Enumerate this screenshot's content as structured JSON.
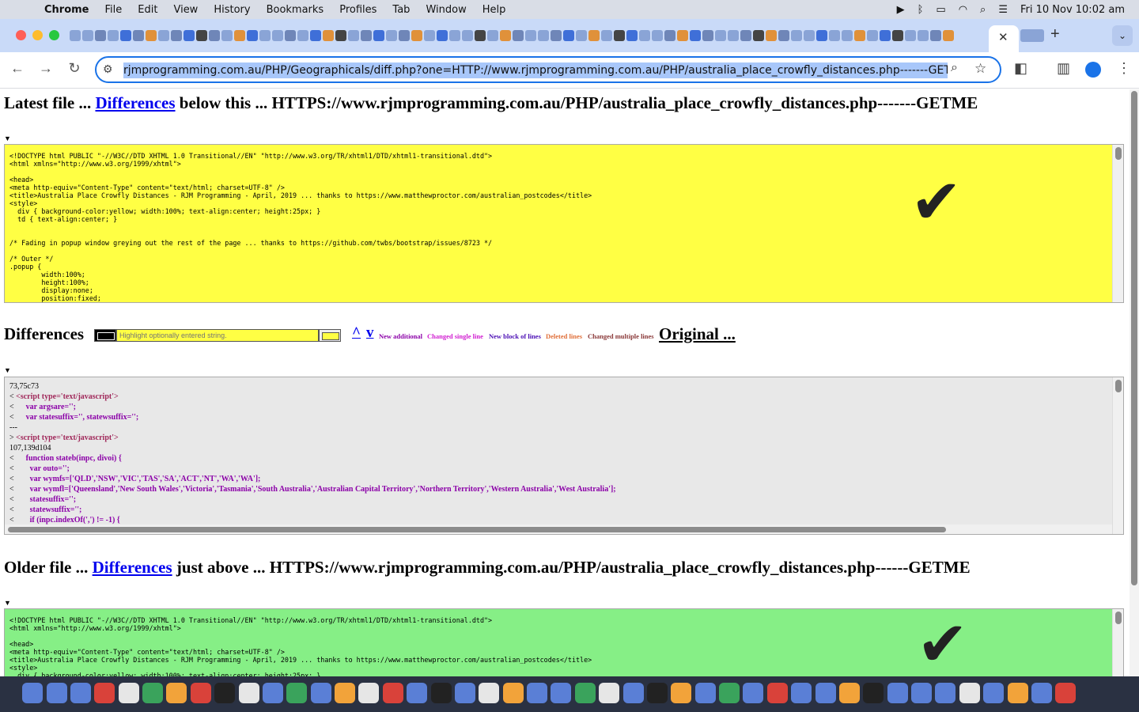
{
  "menubar": {
    "app": "Chrome",
    "items": [
      "File",
      "Edit",
      "View",
      "History",
      "Bookmarks",
      "Profiles",
      "Tab",
      "Window",
      "Help"
    ],
    "datetime": "Fri 10 Nov  10:02 am"
  },
  "toolbar": {
    "url": "rjmprogramming.com.au/PHP/Geographicals/diff.php?one=HTTP://www.rjmprogramming.com.au/PHP/australia_place_crowfly_distances.php-------GETME&f"
  },
  "page": {
    "latest": {
      "prefix": "Latest file ... ",
      "link": "Differences",
      "suffix": " below this ... HTTPS://www.rjmprogramming.com.au/PHP/australia_place_crowfly_distances.php-------GETME",
      "code": "<!DOCTYPE html PUBLIC \"-//W3C//DTD XHTML 1.0 Transitional//EN\" \"http://www.w3.org/TR/xhtml1/DTD/xhtml1-transitional.dtd\">\n<html xmlns=\"http://www.w3.org/1999/xhtml\">\n\n<head>\n<meta http-equiv=\"Content-Type\" content=\"text/html; charset=UTF-8\" />\n<title>Australia Place Crowfly Distances - RJM Programming - April, 2019 ... thanks to https://www.matthewproctor.com/australian_postcodes</title>\n<style>\n  div { background-color:yellow; width:100%; text-align:center; height:25px; }\n  td { text-align:center; }\n\n\n/* Fading in popup window greying out the rest of the page ... thanks to https://github.com/twbs/bootstrap/issues/8723 */\n\n/* Outer */\n.popup {\n        width:100%;\n        height:100%;\n        display:none;\n        position:fixed;"
    },
    "differences": {
      "title": "Differences",
      "search_placeholder": "Highlight optionally entered string.",
      "up": "^",
      "down": "v",
      "legend": [
        {
          "label": "New additional",
          "color": "#8b00a8"
        },
        {
          "label": "Changed single line",
          "color": "#d11fd1"
        },
        {
          "label": "New block of lines",
          "color": "#4b0fb5"
        },
        {
          "label": "Deleted lines",
          "color": "#e0703a"
        },
        {
          "label": "Changed multiple lines",
          "color": "#8b3a3a"
        }
      ],
      "original": "Original ..."
    },
    "diff_lines": [
      {
        "p": "73,75c73",
        "c": ""
      },
      {
        "p": "< ",
        "c": "<script type='text/javascript'>",
        "k": "s"
      },
      {
        "p": "<      ",
        "c": "var argsare='';",
        "k": "p"
      },
      {
        "p": "<      ",
        "c": "var statesuffix='', statewsuffix='';",
        "k": "p"
      },
      {
        "p": "---",
        "c": ""
      },
      {
        "p": "> ",
        "c": "<script type='text/javascript'>",
        "k": "s"
      },
      {
        "p": "107,139d104",
        "c": ""
      },
      {
        "p": "<      ",
        "c": "function stateb(inpc, divoi) {",
        "k": "p"
      },
      {
        "p": "<        ",
        "c": "var outo='';",
        "k": "p"
      },
      {
        "p": "<        ",
        "c": "var wymfs=['QLD','NSW','VIC','TAS','SA','ACT','NT','WA','WA'];",
        "k": "p"
      },
      {
        "p": "<        ",
        "c": "var wymfl=['Queensland','New South Wales','Victoria','Tasmania','South Australia','Australian Capital Territory','Northern Territory','Western Australia','West Australia'];",
        "k": "p"
      },
      {
        "p": "<        ",
        "c": "statesuffix='';",
        "k": "p"
      },
      {
        "p": "<        ",
        "c": "statewsuffix='';",
        "k": "p"
      },
      {
        "p": "<        ",
        "c": "if (inpc.indexOf(',') != -1) {",
        "k": "p"
      }
    ],
    "older": {
      "prefix": "Older file ... ",
      "link": "Differences",
      "suffix": " just above ... HTTPS://www.rjmprogramming.com.au/PHP/australia_place_crowfly_distances.php------GETME",
      "code": "<!DOCTYPE html PUBLIC \"-//W3C//DTD XHTML 1.0 Transitional//EN\" \"http://www.w3.org/TR/xhtml1/DTD/xhtml1-transitional.dtd\">\n<html xmlns=\"http://www.w3.org/1999/xhtml\">\n\n<head>\n<meta http-equiv=\"Content-Type\" content=\"text/html; charset=UTF-8\" />\n<title>Australia Place Crowfly Distances - RJM Programming - April, 2019 ... thanks to https://www.matthewproctor.com/australian_postcodes</title>\n<style>\n  div { background-color:yellow; width:100%; text-align:center; height:25px; }"
    },
    "checkmark": "✔"
  }
}
